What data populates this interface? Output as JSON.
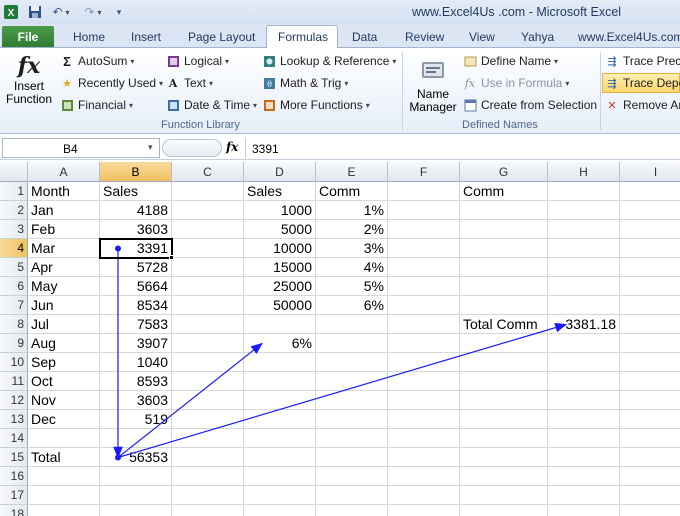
{
  "window": {
    "title": "www.Excel4Us .com  -  Microsoft Excel"
  },
  "ribbon": {
    "tabs": [
      "File",
      "Home",
      "Insert",
      "Page Layout",
      "Formulas",
      "Data",
      "Review",
      "View",
      "Yahya",
      "www.Excel4Us.com"
    ],
    "active_tab": "Formulas",
    "function_library": {
      "insert_function": [
        "Insert",
        "Function"
      ],
      "autosum": "AutoSum",
      "recently_used": "Recently Used",
      "financial": "Financial",
      "logical": "Logical",
      "text": "Text",
      "date_time": "Date & Time",
      "lookup_reference": "Lookup & Reference",
      "math_trig": "Math & Trig",
      "more_functions": "More Functions",
      "group_label": "Function Library"
    },
    "defined_names": {
      "name_manager": [
        "Name",
        "Manager"
      ],
      "define_name": "Define Name",
      "use_in_formula": "Use in Formula",
      "create_from_selection": "Create from Selection",
      "group_label": "Defined Names"
    },
    "formula_auditing": {
      "trace_precedents": "Trace Prece",
      "trace_dependents": "Trace Depe",
      "remove_arrows": "Remove Ar"
    }
  },
  "formula_bar": {
    "name_box": "B4",
    "fx": "fx",
    "value": "3391"
  },
  "sheet": {
    "columns": [
      "A",
      "B",
      "C",
      "D",
      "E",
      "F",
      "G",
      "H",
      "I"
    ],
    "rows": [
      "1",
      "2",
      "3",
      "4",
      "5",
      "6",
      "7",
      "8",
      "9",
      "10",
      "11",
      "12",
      "13",
      "14",
      "15",
      "16",
      "17",
      "18"
    ],
    "selected_column": "B",
    "selected_row": "4",
    "cells": {
      "A1": "Month",
      "B1": "Sales",
      "D1": "Sales",
      "E1": "Comm",
      "G1": "Comm",
      "A2": "Jan",
      "B2": "4188",
      "D2": "1000",
      "E2": "1%",
      "A3": "Feb",
      "B3": "3603",
      "D3": "5000",
      "E3": "2%",
      "A4": "Mar",
      "B4": "3391",
      "D4": "10000",
      "E4": "3%",
      "A5": "Apr",
      "B5": "5728",
      "D5": "15000",
      "E5": "4%",
      "A6": "May",
      "B6": "5664",
      "D6": "25000",
      "E6": "5%",
      "A7": "Jun",
      "B7": "8534",
      "D7": "50000",
      "E7": "6%",
      "A8": "Jul",
      "B8": "7583",
      "G8": "Total Comm",
      "H8": "3381.18",
      "A9": "Aug",
      "B9": "3907",
      "D9": "6%",
      "A10": "Sep",
      "B10": "1040",
      "A11": "Oct",
      "B11": "8593",
      "A12": "Nov",
      "B12": "3603",
      "A13": "Dec",
      "B13": "519",
      "A15": "Total",
      "B15": "56353"
    },
    "arrow_color": "#1a1aff"
  }
}
